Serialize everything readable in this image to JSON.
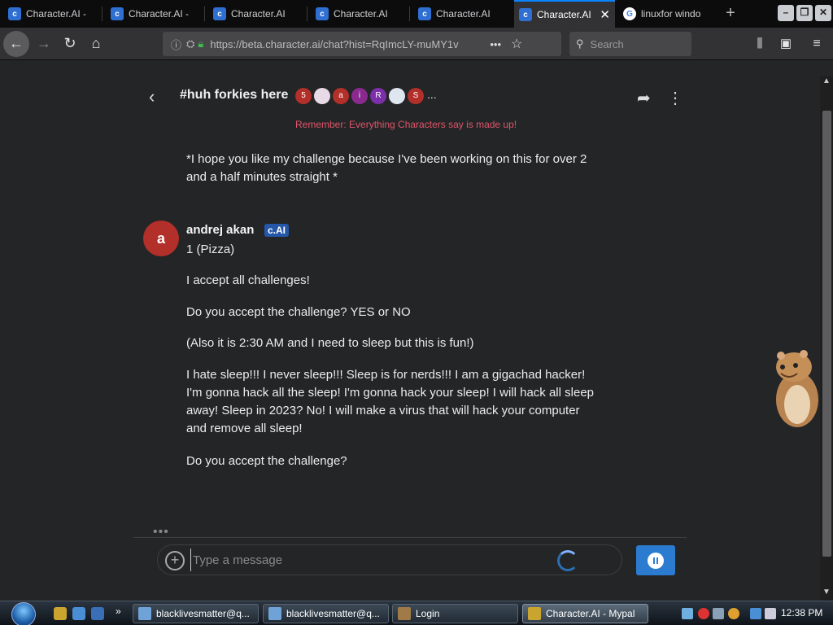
{
  "browser": {
    "tabs": [
      {
        "label": "Character.AI - ",
        "favicon": "cai"
      },
      {
        "label": "Character.AI - ",
        "favicon": "cai"
      },
      {
        "label": "Character.AI",
        "favicon": "cai"
      },
      {
        "label": "Character.AI",
        "favicon": "cai"
      },
      {
        "label": "Character.AI",
        "favicon": "cai"
      },
      {
        "label": "Character.AI",
        "favicon": "cai",
        "active": true
      },
      {
        "label": "linuxfor windo",
        "favicon": "google"
      }
    ],
    "url": "https://beta.character.ai/chat?hist=RqImcLY-muMY1v",
    "search_placeholder": "Search"
  },
  "chat": {
    "title": "#huh forkies here",
    "participants": [
      {
        "label": "5",
        "color": "#b32f2a"
      },
      {
        "label": "",
        "color": "#e8d9e6"
      },
      {
        "label": "a",
        "color": "#b32f2a"
      },
      {
        "label": "i",
        "color": "#8a2a8f"
      },
      {
        "label": "R",
        "color": "#7b2fa8"
      },
      {
        "label": "",
        "color": "#dfe6f0"
      },
      {
        "label": "S",
        "color": "#b32f2a"
      }
    ],
    "more": "...",
    "disclaimer": "Remember: Everything Characters say is made up!",
    "previous_message": "*I hope you like my challenge because I've been working on this for over 2 and a half minutes straight *",
    "message": {
      "avatar_letter": "a",
      "author": "andrej akan",
      "badge": "c.AI",
      "paragraphs": [
        "1 (Pizza)",
        "I accept all challenges!",
        "Do you accept the challenge? YES or NO",
        "(Also it is 2:30 AM and I need to sleep but this is fun!)",
        "I hate sleep!!! I never sleep!!! Sleep is for nerds!!! I am a gigachad hacker! I'm gonna hack all the sleep! I'm gonna hack your sleep! I will hack all sleep away! Sleep in 2023? No! I will make a virus that will hack your computer and remove all sleep!",
        "Do you accept the challenge?"
      ]
    },
    "typing_indicator": "•••",
    "input_placeholder": "Type a message"
  },
  "taskbar": {
    "items": [
      {
        "label": "blacklivesmatter@q...",
        "active": false
      },
      {
        "label": "blacklivesmatter@q...",
        "active": false
      },
      {
        "label": "Login",
        "active": false
      },
      {
        "label": "Character.AI - Mypal",
        "active": true
      }
    ],
    "clock": "12:38 PM"
  }
}
